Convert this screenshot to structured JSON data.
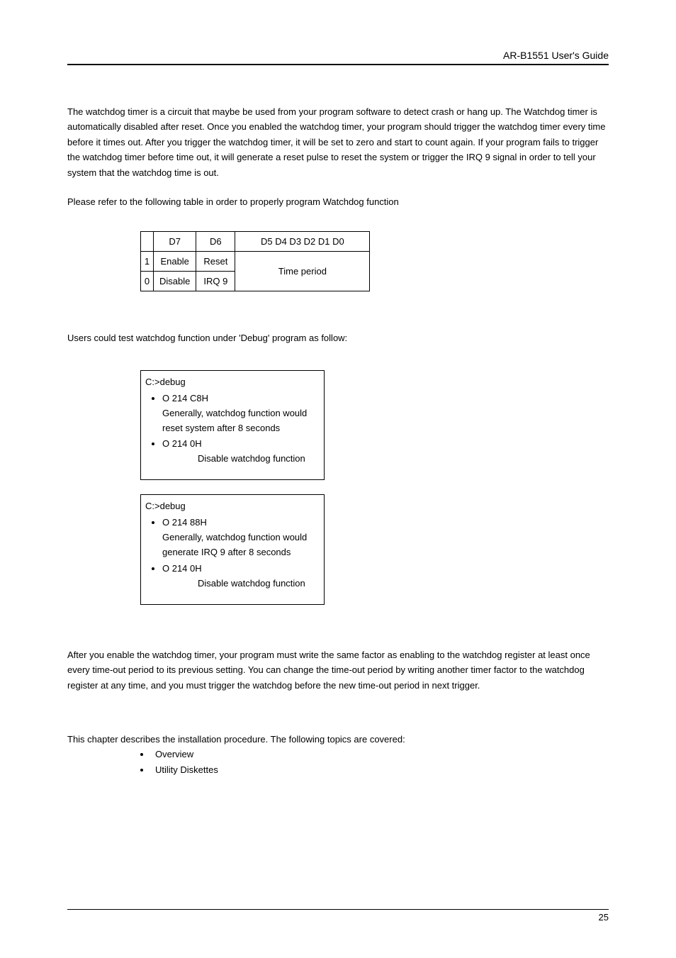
{
  "header": {
    "title": "AR-B1551 User's Guide"
  },
  "intro": {
    "p1": "The watchdog timer is a circuit that maybe be used from your program software to detect crash or hang up. The Watchdog timer is automatically disabled after reset. Once you enabled the watchdog timer, your program should trigger the watchdog timer every time before it times out. After you trigger the watchdog timer, it will be set to zero and start to count again. If your program fails to trigger the watchdog timer before time out, it will generate a reset pulse to reset the system or trigger the IRQ 9 signal in order to tell your system that the watchdog time is out.",
    "p2": "Please refer to the following table in order to properly program Watchdog function"
  },
  "table": {
    "head": {
      "c0": "",
      "d7": "D7",
      "d6": "D6",
      "bits": "D5  D4  D3  D2  D1  D0"
    },
    "row1": {
      "c0": "1",
      "d7": "Enable",
      "d6": "Reset",
      "period": "Time period"
    },
    "row2": {
      "c0": "0",
      "d7": "Disable",
      "d6": "IRQ 9"
    }
  },
  "debug_intro": "Users could test watchdog function under 'Debug' program as follow:",
  "box1": {
    "prompt": "C:>debug",
    "item1_cmd": "O  214  C8H",
    "item1_desc1": "Generally, watchdog function would",
    "item1_desc2": "reset system after 8 seconds",
    "item2_cmd": "O  214  0H",
    "item2_desc": "Disable watchdog function"
  },
  "box2": {
    "prompt": "C:>debug",
    "item1_cmd": "O  214  88H",
    "item1_desc1": "Generally, watchdog function would",
    "item1_desc2": "generate IRQ 9 after 8 seconds",
    "item2_cmd": "O  214  0H",
    "item2_desc": "Disable watchdog function"
  },
  "after": {
    "p": "After you enable the watchdog timer, your program must write the same factor as enabling to the watchdog register at least once every time-out period to its previous setting. You can change the time-out period by writing another timer factor to the watchdog register at any time, and you must trigger the watchdog before the new time-out period in next trigger."
  },
  "install": {
    "intro": "This chapter describes the installation procedure.  The following topics are covered:",
    "items": [
      "Overview",
      "Utility Diskettes"
    ]
  },
  "footer": {
    "page": "25"
  }
}
